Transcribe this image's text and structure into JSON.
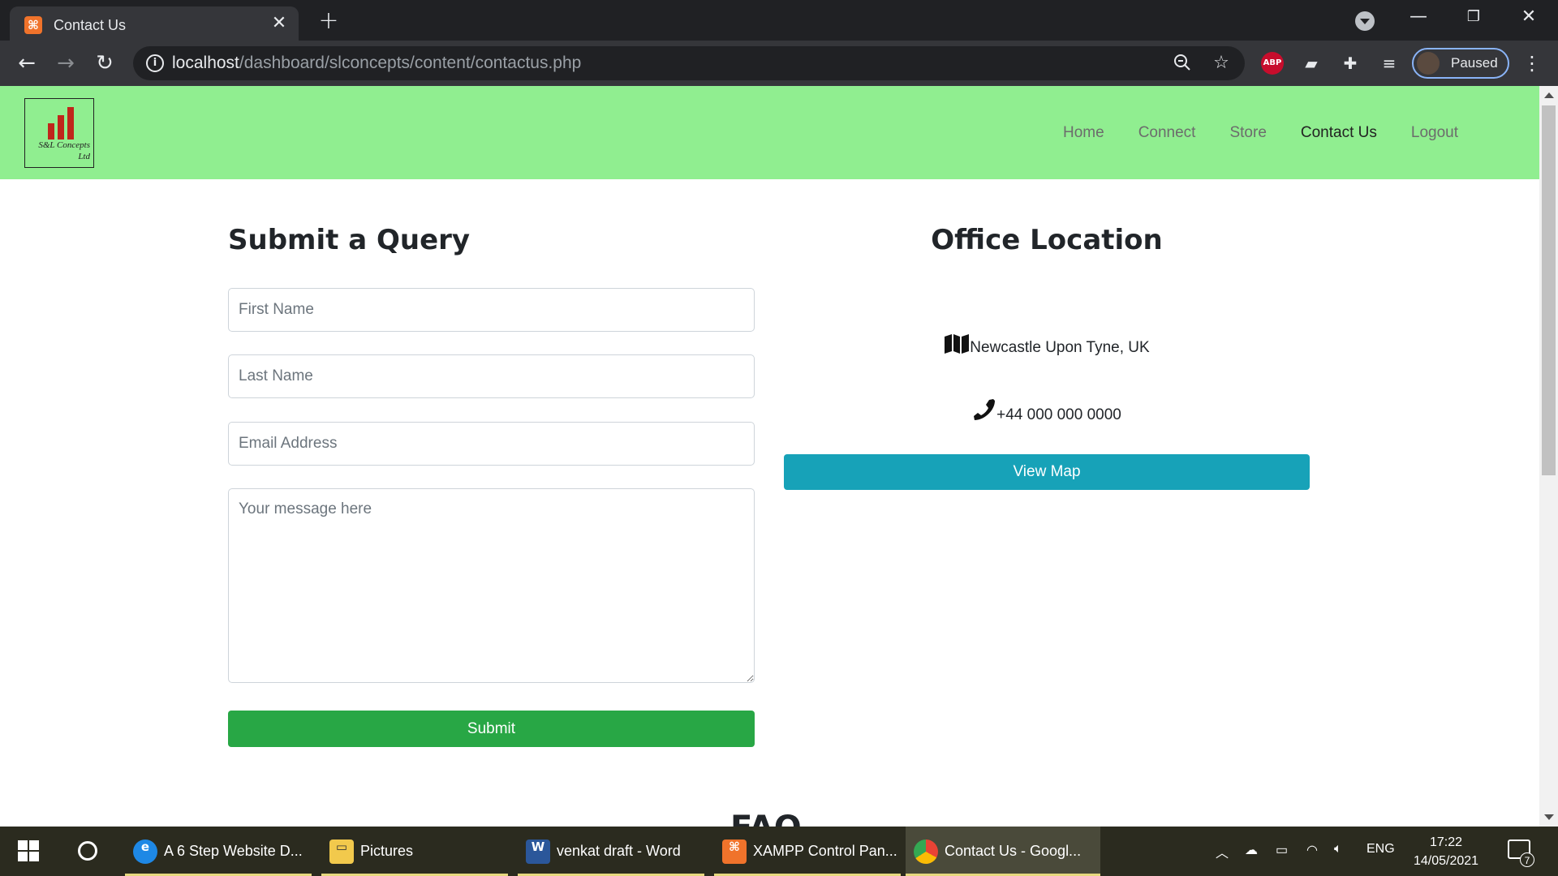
{
  "browser": {
    "tab_title": "Contact Us",
    "favicon_glyph": "⌘",
    "url_host": "localhost",
    "url_path": "/dashboard/slconcepts/content/contactus.php",
    "profile_label": "Paused",
    "abp_label": "ABP"
  },
  "site": {
    "logo_line1": "S&L Concepts",
    "logo_line2": "Ltd",
    "nav": [
      {
        "label": "Home"
      },
      {
        "label": "Connect"
      },
      {
        "label": "Store"
      },
      {
        "label": "Contact Us"
      },
      {
        "label": "Logout"
      }
    ]
  },
  "form": {
    "title": "Submit a Query",
    "first_name_placeholder": "First Name",
    "last_name_placeholder": "Last Name",
    "email_placeholder": "Email Address",
    "message_placeholder": "Your message here",
    "submit_label": "Submit"
  },
  "office": {
    "title": "Office Location",
    "address": "Newcastle Upon Tyne, UK",
    "phone": "+44 000 000 0000",
    "view_map_label": "View Map"
  },
  "faq_peek": "FAQ",
  "taskbar": {
    "items": [
      {
        "label": "A 6 Step Website D..."
      },
      {
        "label": "Pictures"
      },
      {
        "label": "venkat draft - Word"
      },
      {
        "label": "XAMPP Control Pan..."
      },
      {
        "label": "Contact Us - Googl..."
      }
    ],
    "language": "ENG",
    "time": "17:22",
    "date": "14/05/2021",
    "notification_count": "7"
  },
  "colors": {
    "header_bg": "#90ee90",
    "submit_bg": "#28a745",
    "view_map_bg": "#17a2b8"
  }
}
